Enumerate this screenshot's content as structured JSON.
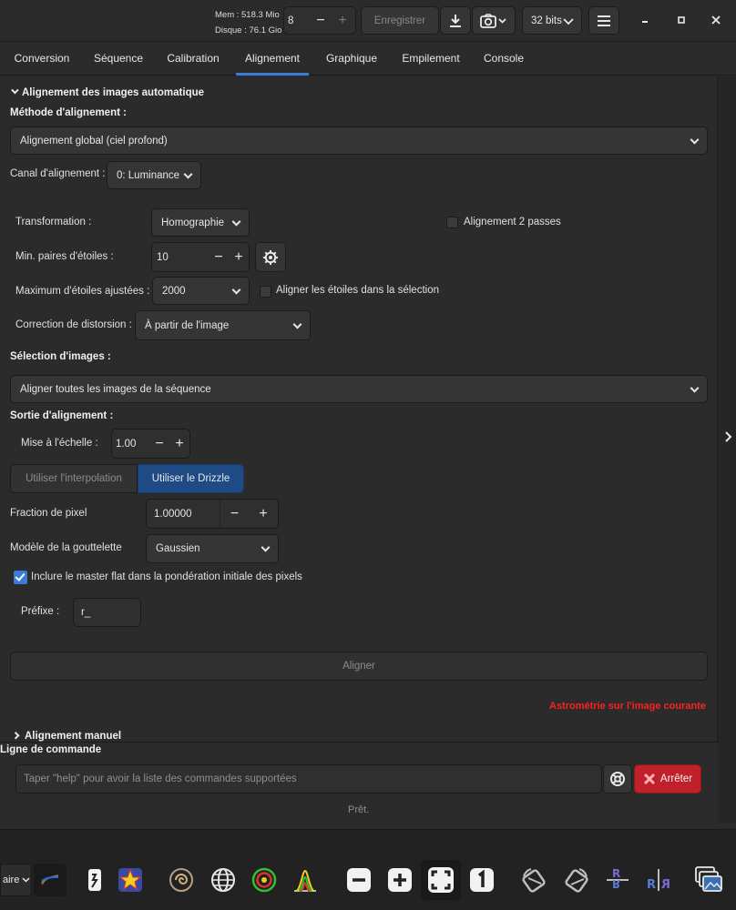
{
  "header": {
    "mem": "Mem : 518.3 Mio",
    "disk": "Disque : 76.1 Gio",
    "threads_value": "8",
    "save_label": "Enregistrer",
    "bits_label": "32 bits"
  },
  "tabs": [
    {
      "label": "Conversion"
    },
    {
      "label": "Séquence"
    },
    {
      "label": "Calibration"
    },
    {
      "label": "Alignement"
    },
    {
      "label": "Graphique"
    },
    {
      "label": "Empilement"
    },
    {
      "label": "Console"
    }
  ],
  "align": {
    "section_title": "Alignement des images automatique",
    "method_label": "Méthode d'alignement :",
    "method_value": "Alignement global (ciel profond)",
    "channel_label": "Canal d'alignement :",
    "channel_value": "0: Luminance",
    "transform_label": "Transformation :",
    "transform_value": "Homographie",
    "two_pass_label": "Alignement 2 passes",
    "min_pairs_label": "Min. paires d'étoiles :",
    "min_pairs_value": "10",
    "max_stars_label": "Maximum d'étoiles ajustées :",
    "max_stars_value": "2000",
    "align_selection_label": "Aligner les étoiles dans la sélection",
    "distortion_label": "Correction de distorsion :",
    "distortion_value": "À partir de l'image",
    "img_selection_label": "Sélection d'images :",
    "img_selection_value": "Aligner toutes les images de la séquence",
    "output_label": "Sortie d'alignement :",
    "scale_label": "Mise à l'échelle :",
    "scale_value": "1.00",
    "interp_label": "Utiliser l'interpolation",
    "drizzle_label": "Utiliser le Drizzle",
    "pixfrac_label": "Fraction de pixel",
    "pixfrac_value": "1.00000",
    "kernel_label": "Modèle de la gouttelette",
    "kernel_value": "Gaussien",
    "masterflat_label": "Inclure le master flat dans la pondération initiale des pixels",
    "prefix_label": "Préfixe :",
    "prefix_value": "r_",
    "align_button": "Aligner",
    "astrometry_link": "Astrométrie sur l'image courante",
    "manual_title": "Alignement manuel"
  },
  "cmdline": {
    "title": "Ligne de commande",
    "placeholder": "Taper \"help\" pour avoir la liste des commandes supportées",
    "stop_label": "Arrêter",
    "status": "Prêt."
  },
  "bottom": {
    "left_combo": "aire"
  },
  "colors": {
    "accent": "#3a7bd5",
    "stop": "#c0202a",
    "link_red": "#ff2020"
  }
}
